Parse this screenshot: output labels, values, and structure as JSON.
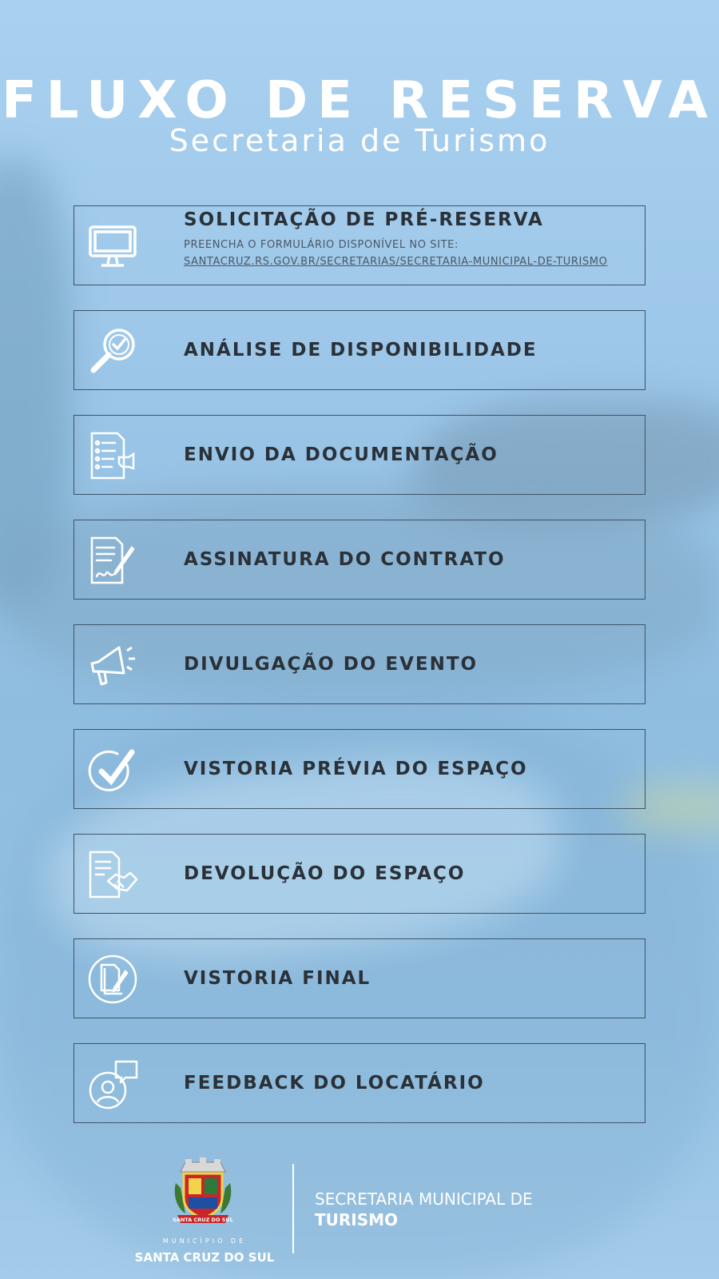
{
  "header": {
    "title": "FLUXO DE RESERVA",
    "subtitle": "Secretaria de Turismo"
  },
  "steps": [
    {
      "label": "SOLICITAÇÃO DE PRÉ-RESERVA",
      "description": "PREENCHA O FORMULÁRIO DISPONÍVEL NO SITE:",
      "link": "SANTACRUZ.RS.GOV.BR/SECRETARIAS/SECRETARIA-MUNICIPAL-DE-TURISMO",
      "icon": "monitor-icon"
    },
    {
      "label": "ANÁLISE DE DISPONIBILIDADE",
      "icon": "magnifier-check-icon"
    },
    {
      "label": "ENVIO DA DOCUMENTAÇÃO",
      "icon": "document-hand-icon"
    },
    {
      "label": "ASSINATURA DO CONTRATO",
      "icon": "contract-pen-icon"
    },
    {
      "label": "DIVULGAÇÃO DO EVENTO",
      "icon": "megaphone-icon"
    },
    {
      "label": "VISTORIA PRÉVIA DO ESPAÇO",
      "icon": "check-circle-icon"
    },
    {
      "label": "DEVOLUÇÃO DO ESPAÇO",
      "icon": "document-handshake-icon"
    },
    {
      "label": "VISTORIA FINAL",
      "icon": "document-circle-icon"
    },
    {
      "label": "FEEDBACK DO LOCATÁRIO",
      "icon": "user-speech-icon"
    }
  ],
  "footer": {
    "municipality_small": "MUNICÍPIO DE",
    "municipality_name": "SANTA CRUZ DO SUL",
    "crest_text": "SANTA CRUZ DO SUL",
    "secretariat_line1": "SECRETARIA MUNICIPAL DE",
    "secretariat_line2": "TURISMO"
  },
  "colors": {
    "background": "#9cc6e8",
    "text_dark": "#2a3138",
    "border": "#3f5466",
    "white": "#ffffff"
  }
}
